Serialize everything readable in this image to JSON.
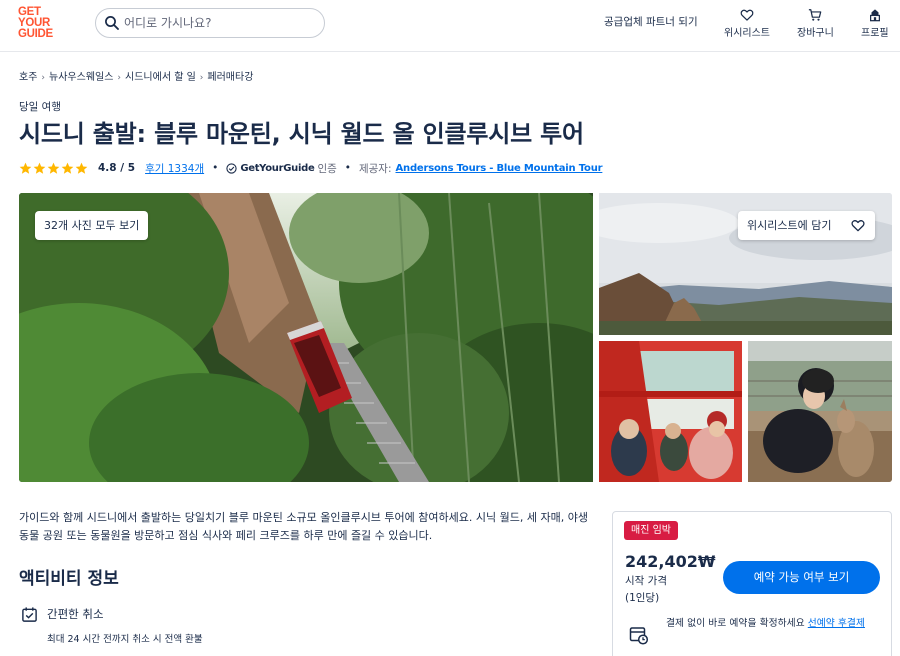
{
  "header": {
    "logo_lines": [
      "GET",
      "YOUR",
      "GUIDE"
    ],
    "search_placeholder": "어디로 가시나요?",
    "partner_link": "공급업체 파트너 되기",
    "nav": [
      {
        "label": "위시리스트",
        "icon": "heart-icon"
      },
      {
        "label": "장바구니",
        "icon": "cart-icon"
      },
      {
        "label": "프로필",
        "icon": "profile-icon"
      }
    ]
  },
  "breadcrumb": [
    "호주",
    "뉴사우스웨일스",
    "시드니에서 할 일",
    "페러매타강"
  ],
  "breadcrumb_separator": "›",
  "activity": {
    "category": "당일 여행",
    "title": "시드니 출발: 블루 마운틴, 시닉 월드 올 인클루시브 투어",
    "rating": "4.8 / 5",
    "stars": 5,
    "reviews": "후기 1334개",
    "bullet": "•",
    "certified_brand": "GetYourGuide",
    "certified_suffix": "인증",
    "provider_label": "제공자:",
    "provider": "Andersons Tours - Blue Mountain Tour"
  },
  "gallery": {
    "all_photos_button": "32개 사진 모두 보기",
    "wishlist_button": "위시리스트에 담기"
  },
  "description": "가이드와 함께 시드니에서 출발하는 당일치기 블루 마운틴 소규모 올인클루시브 투어에 참여하세요. 시닉 월드, 세 자매, 야생동물 공원 또는 동물원을 방문하고 점심 식사와 페리 크루즈를 하루 만에 즐길 수 있습니다.",
  "about": {
    "title": "액티비티 정보",
    "features": [
      {
        "icon": "calendar-check-icon",
        "title": "간편한 취소",
        "subtitle": "최대 24 시간 전까지 취소 시 전액 환불"
      }
    ]
  },
  "booking": {
    "badge": "매진 임박",
    "price": "242,402₩",
    "price_from": "시작 가격",
    "price_per": "(1인당)",
    "check_button": "예약 가능 여부 보기",
    "note_text": "결제 없이 바로 예약을 확정하세요 ",
    "note_link": "선예약 후결제"
  },
  "colors": {
    "brand": "#ff5533",
    "primary": "#0071eb",
    "text": "#1a2b49",
    "badge": "#d81c43",
    "star": "#ffb700"
  }
}
